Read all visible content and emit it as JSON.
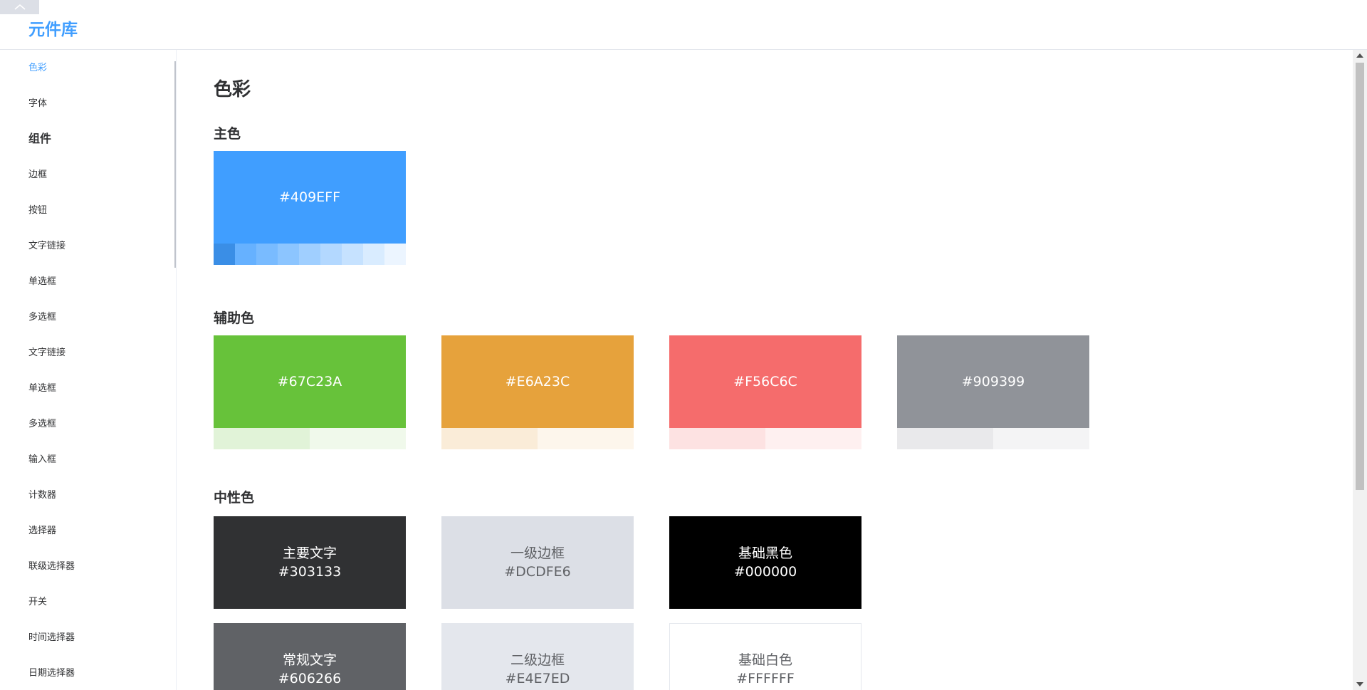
{
  "app": {
    "brand": "元件库"
  },
  "sidebar": {
    "items": [
      {
        "label": "色彩",
        "active": true
      },
      {
        "label": "字体"
      },
      {
        "label": "组件",
        "group": true
      },
      {
        "label": "边框"
      },
      {
        "label": "按钮"
      },
      {
        "label": "文字链接"
      },
      {
        "label": "单选框"
      },
      {
        "label": "多选框"
      },
      {
        "label": "文字链接"
      },
      {
        "label": "单选框"
      },
      {
        "label": "多选框"
      },
      {
        "label": "输入框"
      },
      {
        "label": "计数器"
      },
      {
        "label": "选择器"
      },
      {
        "label": "联级选择器"
      },
      {
        "label": "开关"
      },
      {
        "label": "时间选择器"
      },
      {
        "label": "日期选择器"
      }
    ]
  },
  "main": {
    "title": "色彩",
    "primary": {
      "title": "主色",
      "card": {
        "hex": "#409EFF",
        "color": "#409eff",
        "text_color": "#ffffff",
        "shades": [
          "#3a8ee6",
          "#66b1ff",
          "#79bbff",
          "#8cc5ff",
          "#a0cfff",
          "#b3d8ff",
          "#c6e2ff",
          "#d9ecff",
          "#ecf5ff"
        ]
      }
    },
    "secondary": {
      "title": "辅助色",
      "cards": [
        {
          "hex": "#67C23A",
          "color": "#67c23a",
          "shades": [
            "#e1f3d8",
            "#f0f9eb"
          ]
        },
        {
          "hex": "#E6A23C",
          "color": "#e6a23c",
          "shades": [
            "#faecd8",
            "#fdf6ec"
          ]
        },
        {
          "hex": "#F56C6C",
          "color": "#f56c6c",
          "shades": [
            "#fde2e2",
            "#fef0f0"
          ]
        },
        {
          "hex": "#909399",
          "color": "#909399",
          "shades": [
            "#e9e9eb",
            "#f4f4f5"
          ]
        }
      ]
    },
    "neutral": {
      "title": "中性色",
      "cards": [
        {
          "name": "主要文字",
          "hex": "#303133",
          "color": "#303133",
          "text_color": "#ffffff"
        },
        {
          "name": "一级边框",
          "hex": "#DCDFE6",
          "color": "#dcdfe6",
          "text_color": "#606266"
        },
        {
          "name": "基础黑色",
          "hex": "#000000",
          "color": "#000000",
          "text_color": "#ffffff"
        },
        {
          "name": "常规文字",
          "hex": "#606266",
          "color": "#606266",
          "text_color": "#ffffff"
        },
        {
          "name": "二级边框",
          "hex": "#E4E7ED",
          "color": "#e4e7ed",
          "text_color": "#606266"
        },
        {
          "name": "基础白色",
          "hex": "#FFFFFF",
          "color": "#ffffff",
          "text_color": "#606266"
        }
      ]
    }
  },
  "icons": {
    "collapse": "chevron-up-icon"
  }
}
